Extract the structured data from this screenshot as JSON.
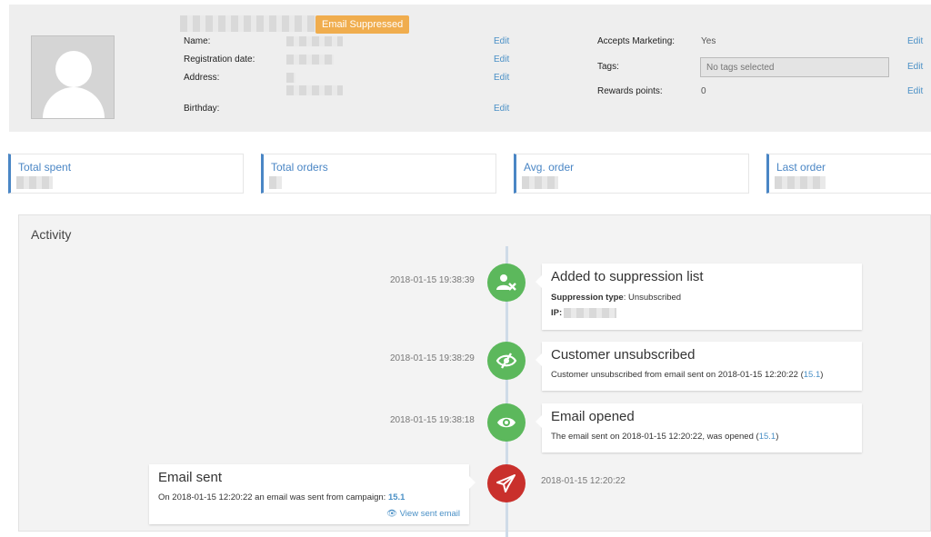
{
  "profile": {
    "badge": "Email Suppressed",
    "name_label": "Name:",
    "registration_label": "Registration date:",
    "address_label": "Address:",
    "birthday_label": "Birthday:",
    "accepts_marketing_label": "Accepts Marketing:",
    "accepts_marketing_value": "Yes",
    "tags_label": "Tags:",
    "tags_placeholder": "No tags selected",
    "rewards_label": "Rewards points:",
    "rewards_value": "0",
    "edit_label": "Edit"
  },
  "stats": [
    {
      "title": "Total spent"
    },
    {
      "title": "Total orders"
    },
    {
      "title": "Avg. order"
    },
    {
      "title": "Last order"
    }
  ],
  "activity": {
    "title": "Activity",
    "events": [
      {
        "timestamp": "2018-01-15 19:38:39",
        "heading": "Added to suppression list",
        "type_label": "Suppression type",
        "type_value": ": Unsubscribed",
        "ip_label": "IP:",
        "icon": "user-remove-icon",
        "color": "#5cb85c"
      },
      {
        "timestamp": "2018-01-15 19:38:29",
        "heading": "Customer unsubscribed",
        "text": "Customer unsubscribed from email sent on 2018-01-15 12:20:22 (",
        "link": "15.1",
        "text_end": ")",
        "icon": "eye-slash-icon",
        "color": "#5cb85c"
      },
      {
        "timestamp": "2018-01-15 19:38:18",
        "heading": "Email opened",
        "text": "The email sent on 2018-01-15 12:20:22, was opened (",
        "link": "15.1",
        "text_end": ")",
        "icon": "eye-icon",
        "color": "#5cb85c"
      },
      {
        "timestamp": "2018-01-15 12:20:22",
        "heading": "Email sent",
        "text": "On 2018-01-15 12:20:22 an email was sent from campaign: ",
        "link": "15.1",
        "view_link": "View sent email",
        "icon": "paper-plane-icon",
        "color": "#c9302c"
      }
    ]
  }
}
